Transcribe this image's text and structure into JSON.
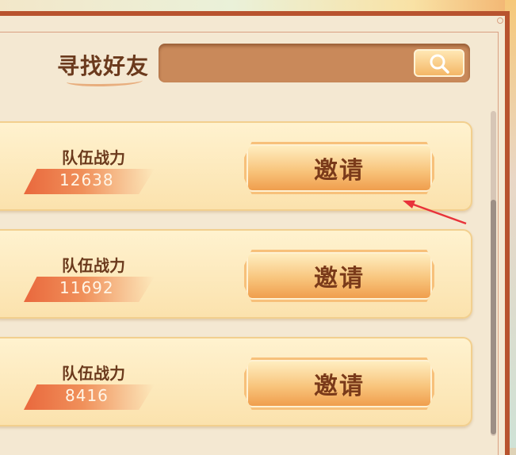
{
  "search": {
    "title": "寻找好友",
    "placeholder": "",
    "button_icon": "search-icon"
  },
  "friends": [
    {
      "power_label": "队伍战力",
      "power_value": "12638",
      "invite_label": "邀请"
    },
    {
      "power_label": "队伍战力",
      "power_value": "11692",
      "invite_label": "邀请"
    },
    {
      "power_label": "队伍战力",
      "power_value": "8416",
      "invite_label": "邀请"
    }
  ],
  "colors": {
    "frame": "#b8532e",
    "panel": "#f4e8d2",
    "card": "#fbe2ad",
    "invite_button": "#ef9b49",
    "text_brown": "#6b3a1d",
    "annotation_arrow": "#e8333a"
  }
}
